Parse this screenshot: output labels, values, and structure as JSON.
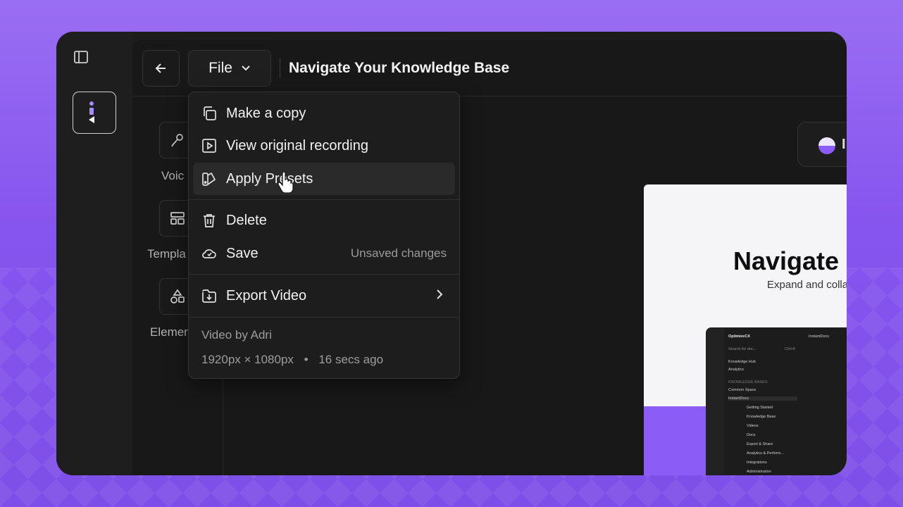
{
  "topbar": {
    "file_label": "File",
    "document_title": "Navigate Your Knowledge Base"
  },
  "tools": [
    {
      "label": "Voic",
      "icon": "microphone-icon"
    },
    {
      "label": "Templa",
      "icon": "template-icon"
    },
    {
      "label": "Elemen",
      "icon": "shapes-icon"
    }
  ],
  "file_menu": {
    "items": [
      {
        "label": "Make a copy",
        "icon": "copy-icon"
      },
      {
        "label": "View original recording",
        "icon": "play-icon"
      },
      {
        "label": "Apply Presets",
        "icon": "presets-icon"
      },
      {
        "label": "Delete",
        "icon": "trash-icon"
      },
      {
        "label": "Save",
        "icon": "cloud-icon",
        "hint": "Unsaved changes"
      },
      {
        "label": "Export Video",
        "icon": "export-icon"
      }
    ],
    "author": "Video by Adri",
    "dimensions": "1920px × 1080px",
    "separator": "•",
    "updated": "16 secs ago"
  },
  "preview": {
    "pill_text": "I",
    "title": "Navigate",
    "subtitle": "Expand and colla",
    "mini_app": {
      "workspace": "OptimizeCX",
      "search_placeholder": "Search for doc...",
      "shortcut": "Ctrl+K",
      "tab": "InstantDocs",
      "nav": [
        "Knowledge Hub",
        "Analytics"
      ],
      "section": "KNOWLEDGE BASES",
      "bases": [
        "Common Space",
        "InstantDocs"
      ],
      "pages": [
        "Getting Started",
        "Knowledge Base",
        "Videos",
        "Docs",
        "Export & Share",
        "Analytics & Perform...",
        "Integrations",
        "Administration"
      ]
    }
  },
  "colors": {
    "background": "#8b5cf6",
    "accent": "#8b5cf6",
    "app_bg": "#1c1c1d"
  }
}
